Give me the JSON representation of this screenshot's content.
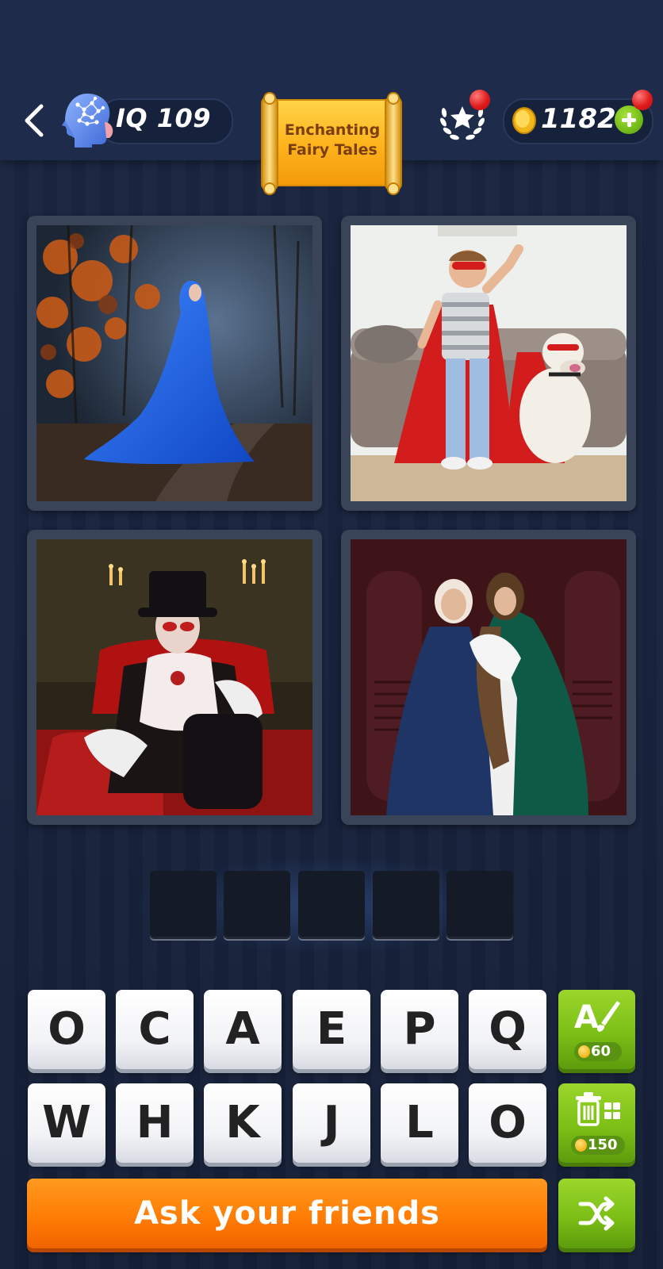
{
  "header": {
    "iq_label": "IQ 109",
    "category_line1": "Enchanting",
    "category_line2": "Fairy Tales",
    "coins": "1182"
  },
  "photos": [
    {
      "description": "woman-in-blue-cloak-forest"
    },
    {
      "description": "boy-and-dog-in-red-capes"
    },
    {
      "description": "vampire-in-red-cape"
    },
    {
      "description": "two-women-in-hooded-cloaks"
    }
  ],
  "answer": {
    "slots": [
      "",
      "",
      "",
      "",
      ""
    ]
  },
  "keyboard": {
    "row1": [
      "O",
      "C",
      "A",
      "E",
      "P",
      "Q"
    ],
    "row2": [
      "W",
      "H",
      "K",
      "J",
      "L",
      "O"
    ]
  },
  "hints": {
    "reveal_cost": "60",
    "remove_cost": "150"
  },
  "ask_friends_label": "Ask your friends",
  "colors": {
    "accent_green": "#7cbf16",
    "accent_orange": "#ff7d05",
    "background": "#17233d"
  }
}
